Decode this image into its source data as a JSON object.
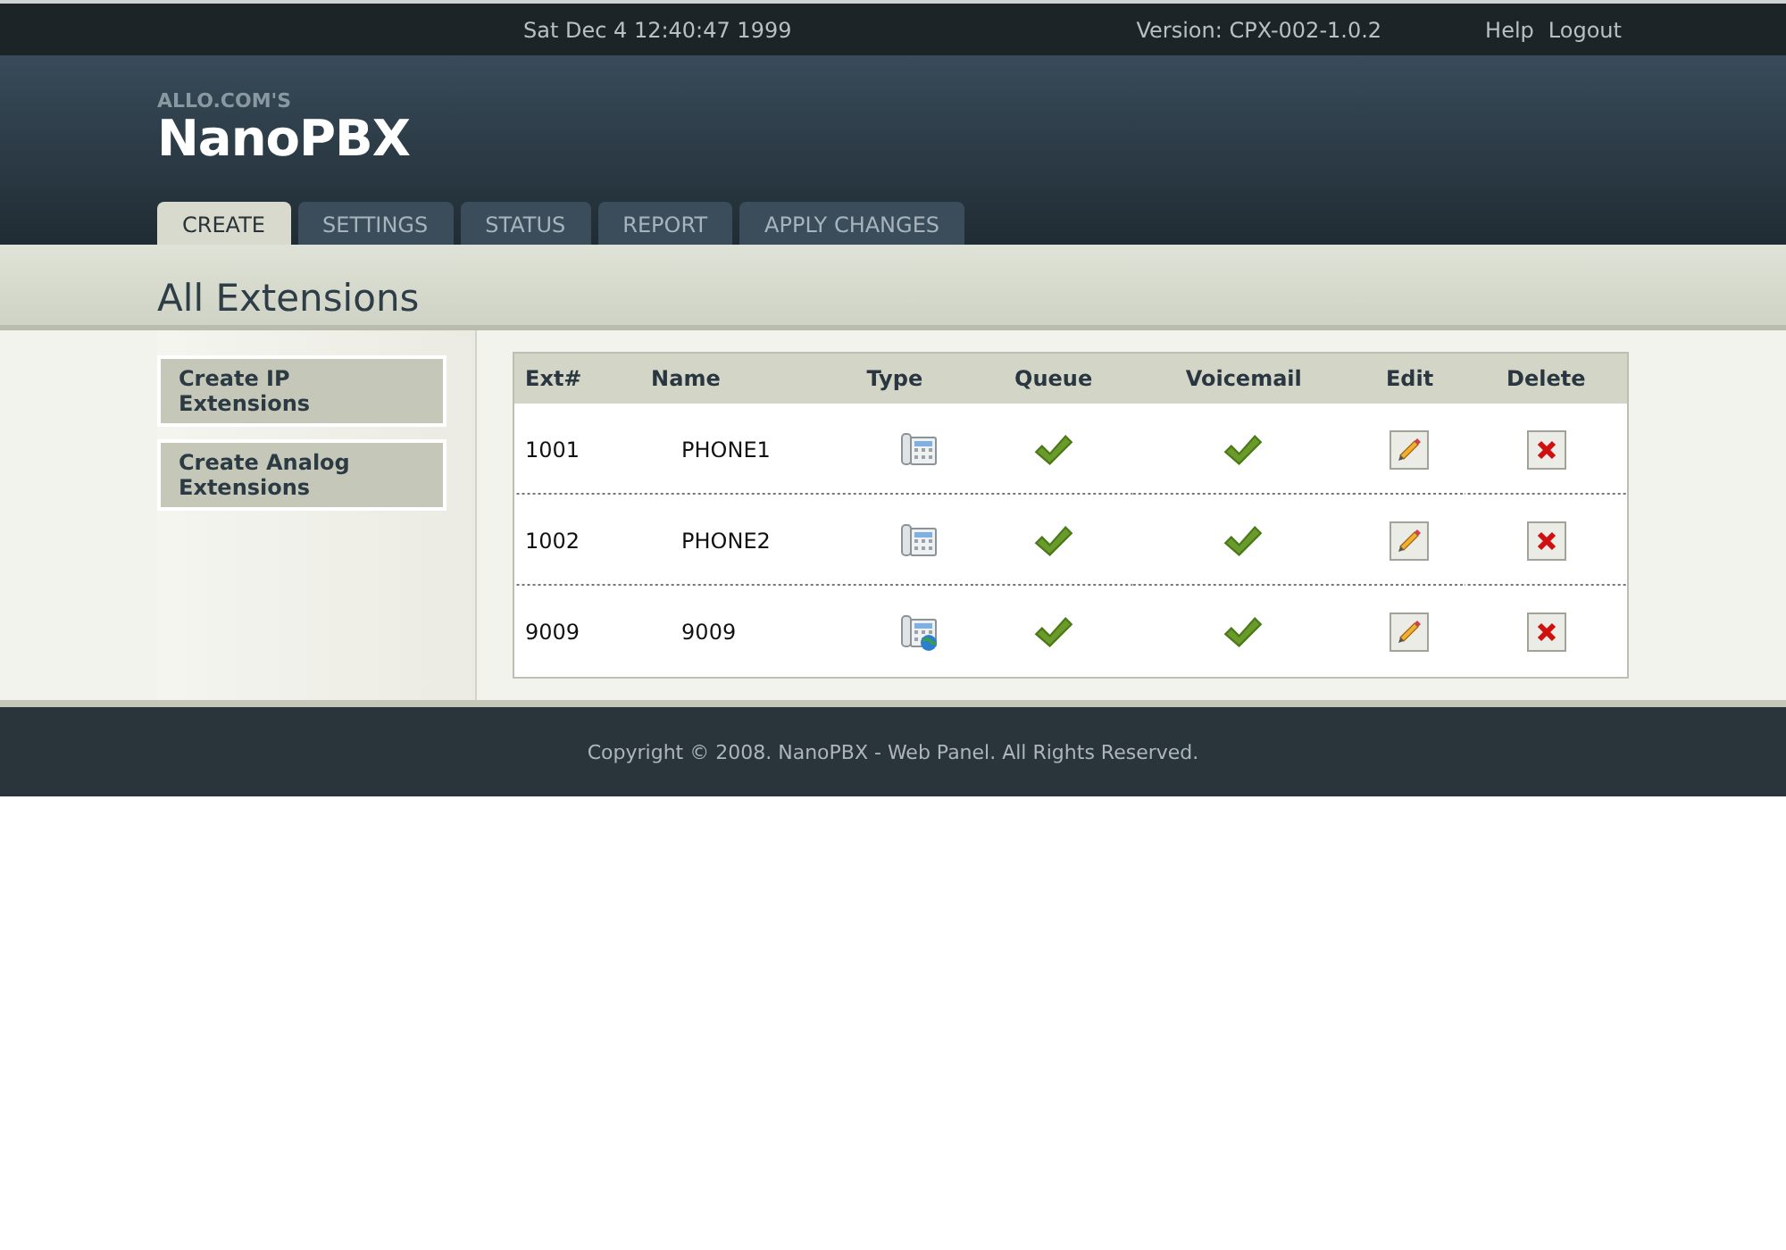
{
  "top_bar": {
    "datetime": "Sat Dec 4 12:40:47 1999",
    "version": "Version: CPX-002-1.0.2",
    "links": [
      "Help",
      "Logout"
    ]
  },
  "logo": {
    "tagline": "ALLO.COM'S",
    "name": "NanoPBX"
  },
  "tabs": [
    {
      "label": "CREATE",
      "selected": true
    },
    {
      "label": "SETTINGS",
      "selected": false
    },
    {
      "label": "STATUS",
      "selected": false
    },
    {
      "label": "REPORT",
      "selected": false
    },
    {
      "label": "APPLY CHANGES",
      "selected": false
    }
  ],
  "page_title": "All Extensions",
  "sidebar": {
    "items": [
      "Create IP Extensions",
      "Create Analog Extensions"
    ]
  },
  "table": {
    "columns": [
      "Ext#",
      "Name",
      "Type",
      "Queue",
      "Voicemail",
      "Edit",
      "Delete"
    ],
    "rows": [
      {
        "ext": "1001",
        "name": "PHONE1",
        "kind": "phone",
        "queue": true,
        "voicemail": true
      },
      {
        "ext": "1002",
        "name": "PHONE2",
        "kind": "phone",
        "queue": true,
        "voicemail": true
      },
      {
        "ext": "9009",
        "name": "9009",
        "kind": "ip-phone",
        "queue": true,
        "voicemail": true
      }
    ]
  },
  "footer": "Copyright © 2008. NanoPBX - Web Panel. All Rights Reserved."
}
